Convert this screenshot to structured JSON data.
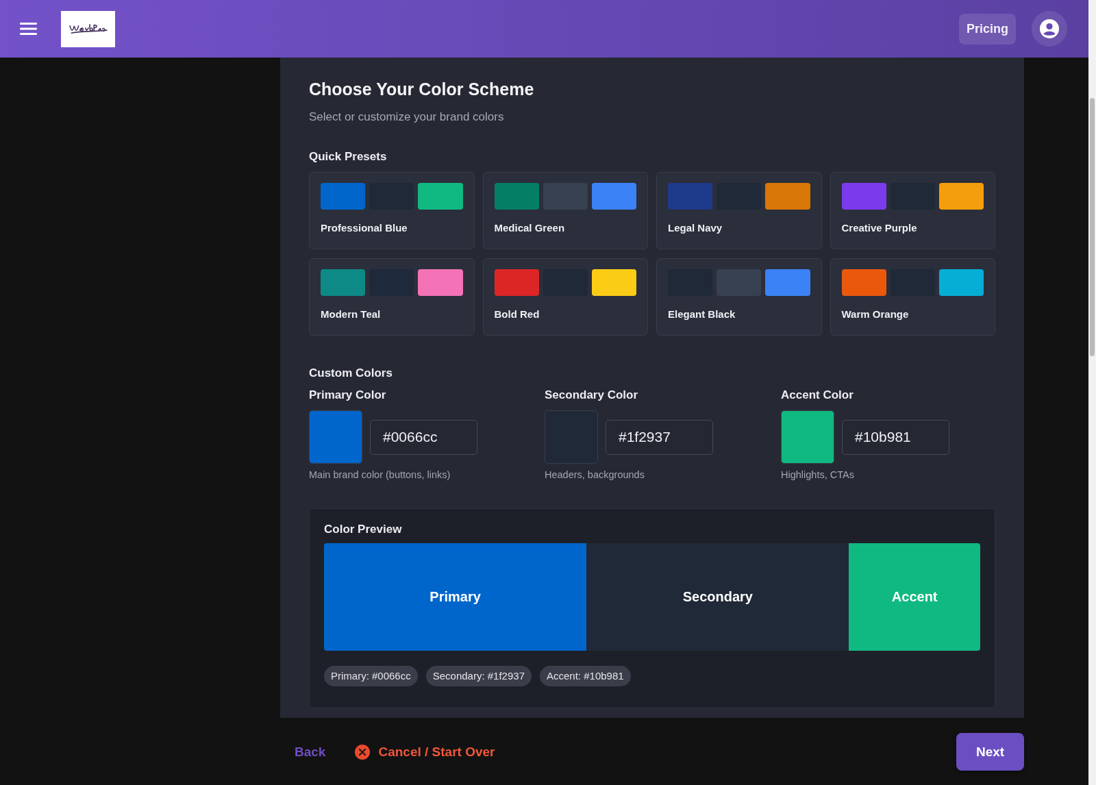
{
  "header": {
    "pricing": "Pricing"
  },
  "page": {
    "title": "Choose Your Color Scheme",
    "subtitle": "Select or customize your brand colors"
  },
  "presets": {
    "heading": "Quick Presets",
    "items": [
      {
        "name": "Professional Blue",
        "swatches": [
          {
            "color": "#0066cc"
          },
          {
            "color": "#1f2937"
          },
          {
            "color": "#10b981"
          }
        ],
        "selected": false
      },
      {
        "name": "Medical Green",
        "swatches": [
          {
            "color": "#047e64"
          },
          {
            "color": "#374151"
          },
          {
            "color": "#3b82f6"
          }
        ],
        "selected": false
      },
      {
        "name": "Legal Navy",
        "swatches": [
          {
            "color": "#1e3a8a"
          },
          {
            "color": "#1f2937"
          },
          {
            "color": "#d97706"
          }
        ],
        "selected": false
      },
      {
        "name": "Creative Purple",
        "swatches": [
          {
            "color": "#7c3aed"
          },
          {
            "color": "#1f2937"
          },
          {
            "color": "#f59e0b"
          }
        ],
        "selected": false
      },
      {
        "name": "Modern Teal",
        "swatches": [
          {
            "color": "#0d8a85"
          },
          {
            "color": "#1e293b"
          },
          {
            "color": "#f472b6"
          }
        ],
        "selected": false
      },
      {
        "name": "Bold Red",
        "swatches": [
          {
            "color": "#dc2626"
          },
          {
            "color": "#1f2937"
          },
          {
            "color": "#facc15"
          }
        ],
        "selected": false
      },
      {
        "name": "Elegant Black",
        "swatches": [
          {
            "color": "#1f2937"
          },
          {
            "color": "#374151"
          },
          {
            "color": "#3b82f6"
          }
        ],
        "selected": false
      },
      {
        "name": "Warm Orange",
        "swatches": [
          {
            "color": "#ea580c"
          },
          {
            "color": "#1f2937"
          },
          {
            "color": "#06aed5"
          }
        ],
        "selected": false
      }
    ]
  },
  "custom": {
    "heading": "Custom Colors",
    "fields": [
      {
        "label": "Primary Color",
        "color": "#0066cc",
        "value": "#0066cc",
        "hint": "Main brand color (buttons, links)"
      },
      {
        "label": "Secondary Color",
        "color": "#1f2937",
        "value": "#1f2937",
        "hint": "Headers, backgrounds"
      },
      {
        "label": "Accent Color",
        "color": "#10b981",
        "value": "#10b981",
        "hint": "Highlights, CTAs"
      }
    ]
  },
  "preview": {
    "heading": "Color Preview",
    "segments": [
      {
        "label": "Primary",
        "color": "#0066cc"
      },
      {
        "label": "Secondary",
        "color": "#1f2937"
      },
      {
        "label": "Accent",
        "color": "#10b981"
      }
    ],
    "chips": [
      "Primary: #0066cc",
      "Secondary: #1f2937",
      "Accent: #10b981"
    ]
  },
  "footer": {
    "back": "Back",
    "cancel": "Cancel / Start Over",
    "next": "Next"
  }
}
